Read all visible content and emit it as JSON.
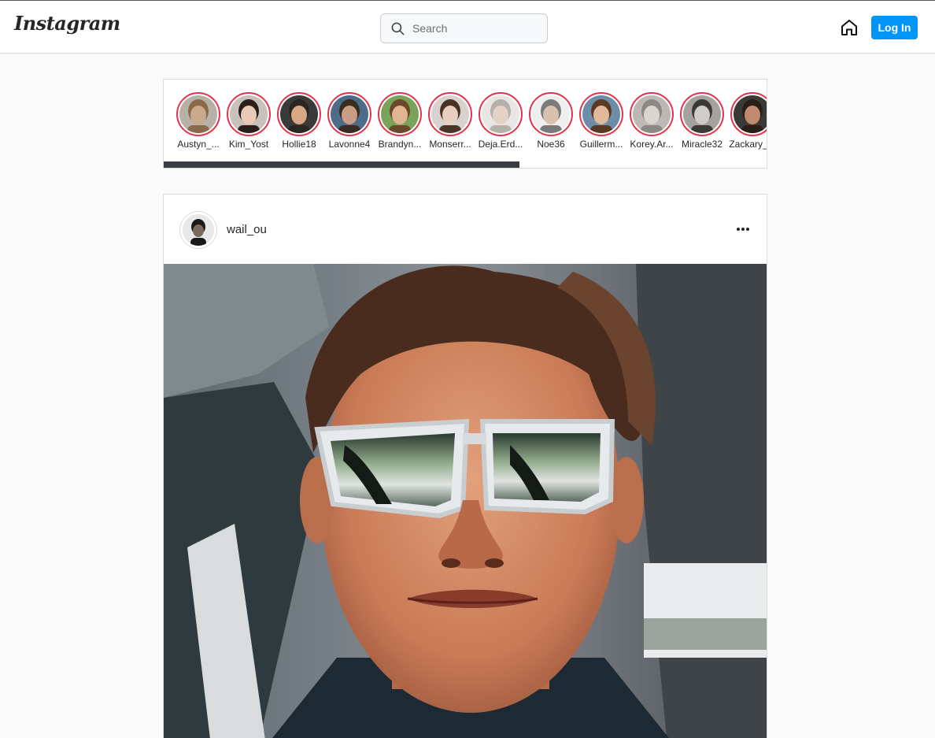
{
  "header": {
    "logo_text": "Instagram",
    "search": {
      "placeholder": "Search",
      "value": ""
    },
    "home_icon": "home-icon",
    "login_label": "Log In"
  },
  "stories": {
    "items": [
      {
        "name": "Austyn_...",
        "skin": "#c9a98a",
        "hair": "#8a6a4a",
        "bg": "#b7b0a6"
      },
      {
        "name": "Kim_Yost",
        "skin": "#e8c9b6",
        "hair": "#2a1f1a",
        "bg": "#c7c0bb"
      },
      {
        "name": "Hollie18",
        "skin": "#d9a883",
        "hair": "#2b2622",
        "bg": "#3a3a3a"
      },
      {
        "name": "Lavonne4",
        "skin": "#c99e84",
        "hair": "#3a2c22",
        "bg": "#4d6c8a"
      },
      {
        "name": "Brandyn...",
        "skin": "#e2b592",
        "hair": "#6b4a2c",
        "bg": "#7aa35a"
      },
      {
        "name": "Monserr...",
        "skin": "#e8cfc0",
        "hair": "#4a3428",
        "bg": "#d7d2cd"
      },
      {
        "name": "Deja.Erd...",
        "skin": "#e5d2c6",
        "hair": "#b5b0aa",
        "bg": "#e9e6e3"
      },
      {
        "name": "Noe36",
        "skin": "#d9c1ae",
        "hair": "#7a7a7a",
        "bg": "#eeeeee"
      },
      {
        "name": "Guillerm...",
        "skin": "#e0b89a",
        "hair": "#5a3a22",
        "bg": "#6d8ca8"
      },
      {
        "name": "Korey.Ar...",
        "skin": "#d9d5d0",
        "hair": "#8c8884",
        "bg": "#bdb8b3"
      },
      {
        "name": "Miracle32",
        "skin": "#cfcbc8",
        "hair": "#3c3a38",
        "bg": "#a5a19d"
      },
      {
        "name": "Zackary_...",
        "skin": "#c28a6e",
        "hair": "#2a1e18",
        "bg": "#3c3a36"
      }
    ],
    "scroll_fraction": 0.59
  },
  "post": {
    "username": "wail_ou",
    "more_icon": "more-horizontal-icon",
    "image_subject": "selfie-with-sunglasses"
  },
  "colors": {
    "accent": "#0095f6",
    "story_ring": "#e2344a",
    "border": "#dbdbdb",
    "background": "#fafafa"
  }
}
